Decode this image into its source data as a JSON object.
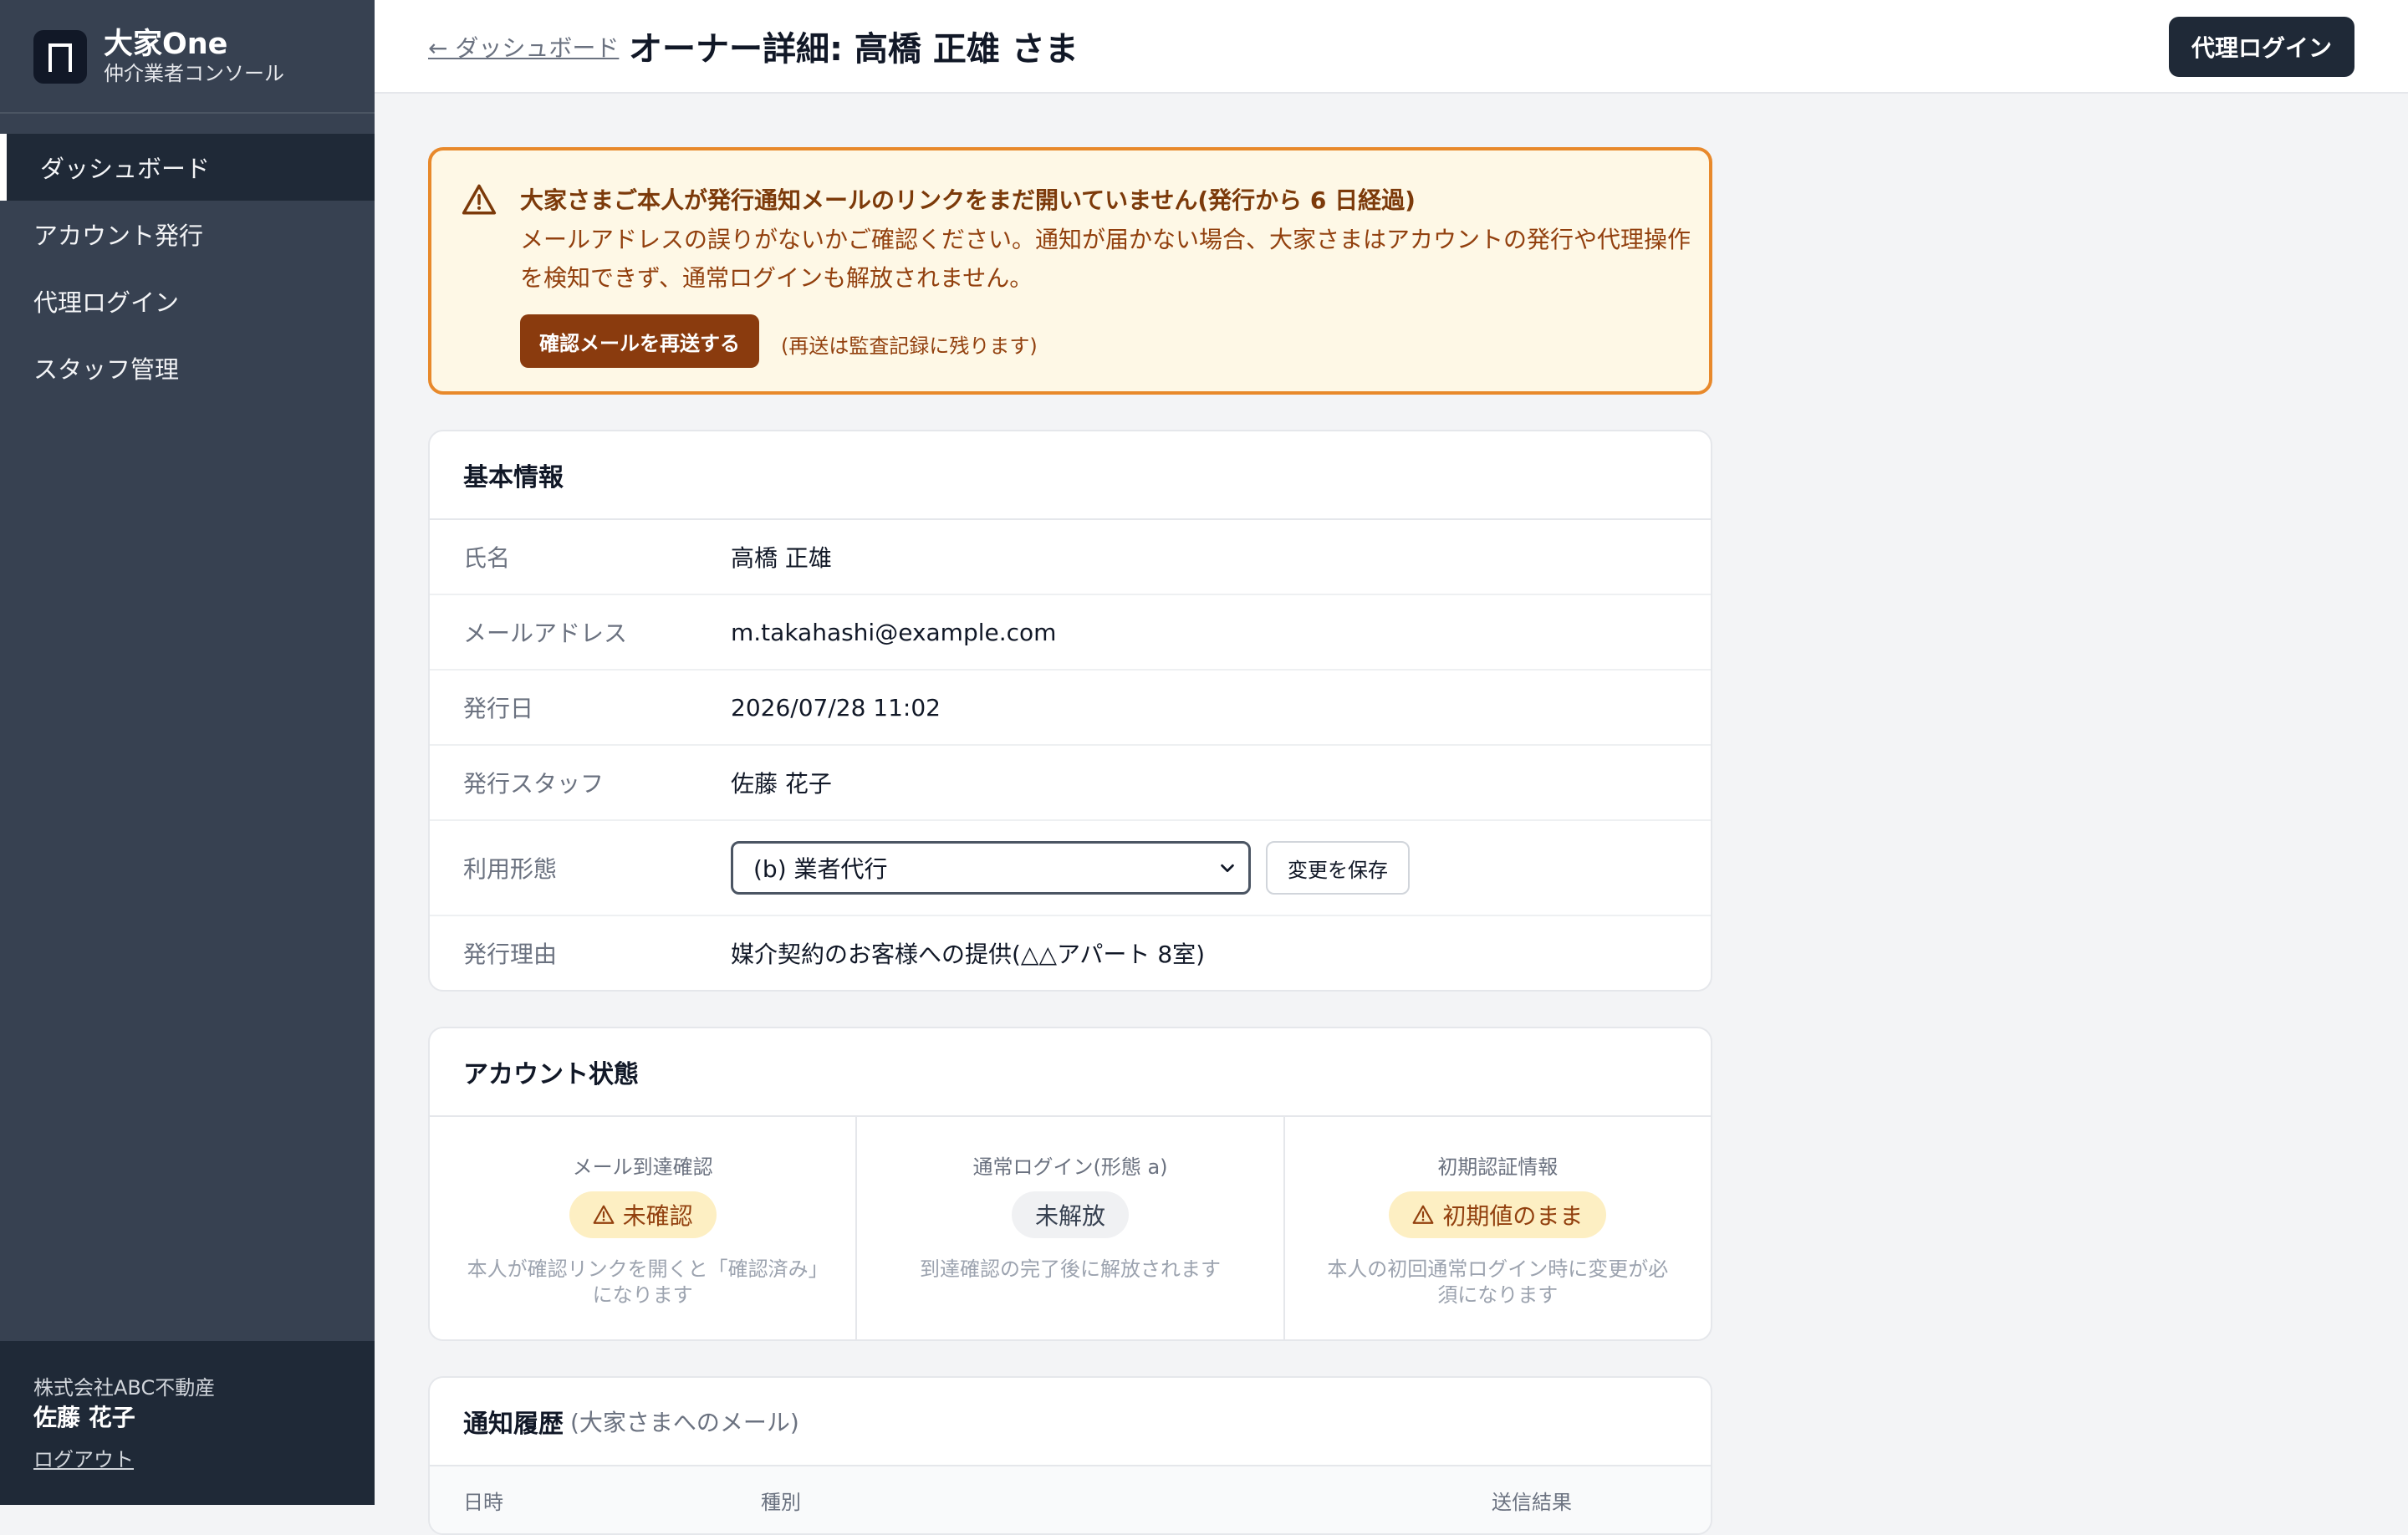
{
  "sidebar": {
    "brand_name": "大家One",
    "brand_sub": "仲介業者コンソール",
    "items": [
      {
        "label": "ダッシュボード"
      },
      {
        "label": "アカウント発行"
      },
      {
        "label": "代理ログイン"
      },
      {
        "label": "スタッフ管理"
      }
    ],
    "company": "株式会社ABC不動産",
    "staff_name": "佐藤 花子",
    "logout": "ログアウト"
  },
  "header": {
    "back": "← ダッシュボード",
    "title": "オーナー詳細: 高橋 正雄 さま",
    "proxy_login": "代理ログイン"
  },
  "alert": {
    "title": "大家さまご本人が発行通知メールのリンクをまだ開いていません(発行から 6 日経過)",
    "body": "メールアドレスの誤りがないかご確認ください。通知が届かない場合、大家さまはアカウントの発行や代理操作を検知できず、通常ログインも解放されません。",
    "resend_button": "確認メールを再送する",
    "resend_note": "(再送は監査記録に残ります)"
  },
  "basic_info": {
    "title": "基本情報",
    "rows": [
      {
        "label": "氏名",
        "value": "高橋 正雄"
      },
      {
        "label": "メールアドレス",
        "value": "m.takahashi@example.com"
      },
      {
        "label": "発行日",
        "value": "2026/07/28 11:02"
      },
      {
        "label": "発行スタッフ",
        "value": "佐藤 花子"
      }
    ],
    "usage_label": "利用形態",
    "usage_selected": "(b) 業者代行",
    "save_button": "変更を保存",
    "reason_label": "発行理由",
    "reason_value": "媒介契約のお客様への提供(△△アパート 8室)"
  },
  "account_status": {
    "title": "アカウント状態",
    "cells": [
      {
        "label": "メール到達確認",
        "badge": "未確認",
        "desc": "本人が確認リンクを開くと「確認済み」になります"
      },
      {
        "label": "通常ログイン(形態 a)",
        "badge": "未解放",
        "desc": "到達確認の完了後に解放されます"
      },
      {
        "label": "初期認証情報",
        "badge": "初期値のまま",
        "desc": "本人の初回通常ログイン時に変更が必須になります"
      }
    ]
  },
  "history": {
    "title": "通知履歴",
    "subtitle": "(大家さまへのメール)",
    "columns": [
      "日時",
      "種別",
      "送信結果"
    ]
  },
  "colors": {
    "sidebar_bg": "#374151",
    "accent_dark": "#1f2937",
    "warning_border": "#e8892b",
    "warning_bg": "#fef8e6",
    "resend_button": "#8a3b0e"
  }
}
